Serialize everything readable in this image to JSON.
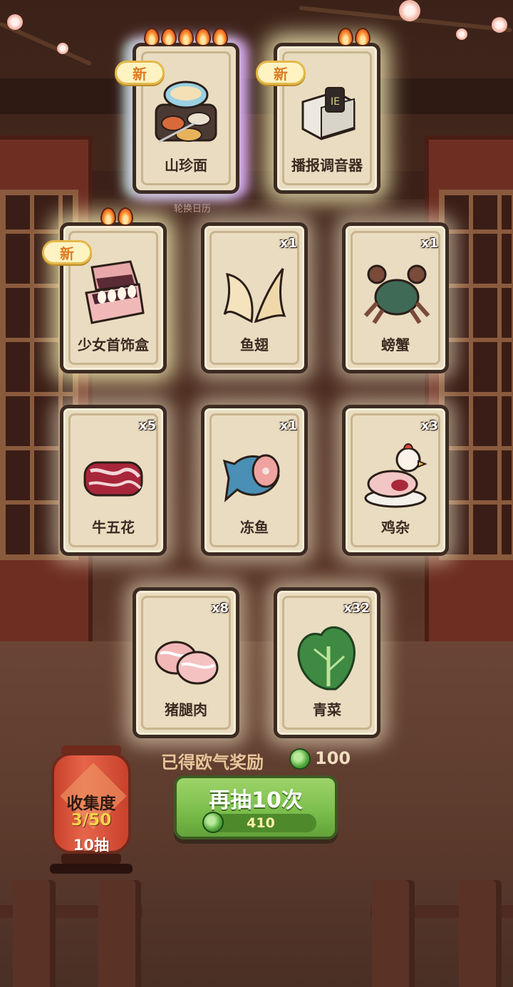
{
  "cards": [
    {
      "name": "山珍面",
      "qty": "",
      "new": true,
      "new_label": "新",
      "flames": 5,
      "icon": "noodle-feast-icon"
    },
    {
      "name": "播报调音器",
      "qty": "",
      "new": true,
      "new_label": "新",
      "flames": 2,
      "icon": "radio-tuner-icon"
    },
    {
      "name": "少女首饰盒",
      "qty": "",
      "new": true,
      "new_label": "新",
      "flames": 2,
      "icon": "jewelry-box-icon"
    },
    {
      "name": "鱼翅",
      "qty": "x1",
      "new": false,
      "flames": 0,
      "icon": "shark-fin-icon"
    },
    {
      "name": "螃蟹",
      "qty": "x1",
      "new": false,
      "flames": 0,
      "icon": "crab-icon"
    },
    {
      "name": "牛五花",
      "qty": "x5",
      "new": false,
      "flames": 0,
      "icon": "beef-belly-icon"
    },
    {
      "name": "冻鱼",
      "qty": "x1",
      "new": false,
      "flames": 0,
      "icon": "frozen-fish-icon"
    },
    {
      "name": "鸡杂",
      "qty": "x3",
      "new": false,
      "flames": 0,
      "icon": "chicken-giblets-icon"
    },
    {
      "name": "猪腿肉",
      "qty": "x8",
      "new": false,
      "flames": 0,
      "icon": "pork-leg-icon"
    },
    {
      "name": "青菜",
      "qty": "x32",
      "new": false,
      "flames": 0,
      "icon": "greens-icon"
    }
  ],
  "background_label": "轮换日历",
  "reward": {
    "label": "已得欧气奖励",
    "value": "100",
    "icon": "green-coin-icon"
  },
  "draw_button": {
    "label": "再抽10次",
    "cost": "410",
    "icon": "green-coin-icon"
  },
  "collection": {
    "title": "收集度",
    "progress": "3/50",
    "draws": "10抽"
  },
  "colors": {
    "card_bg": "#e9dcc0",
    "card_border": "#3b2a22",
    "button_green": "#7cbf4c",
    "lantern_red": "#c9412c"
  }
}
